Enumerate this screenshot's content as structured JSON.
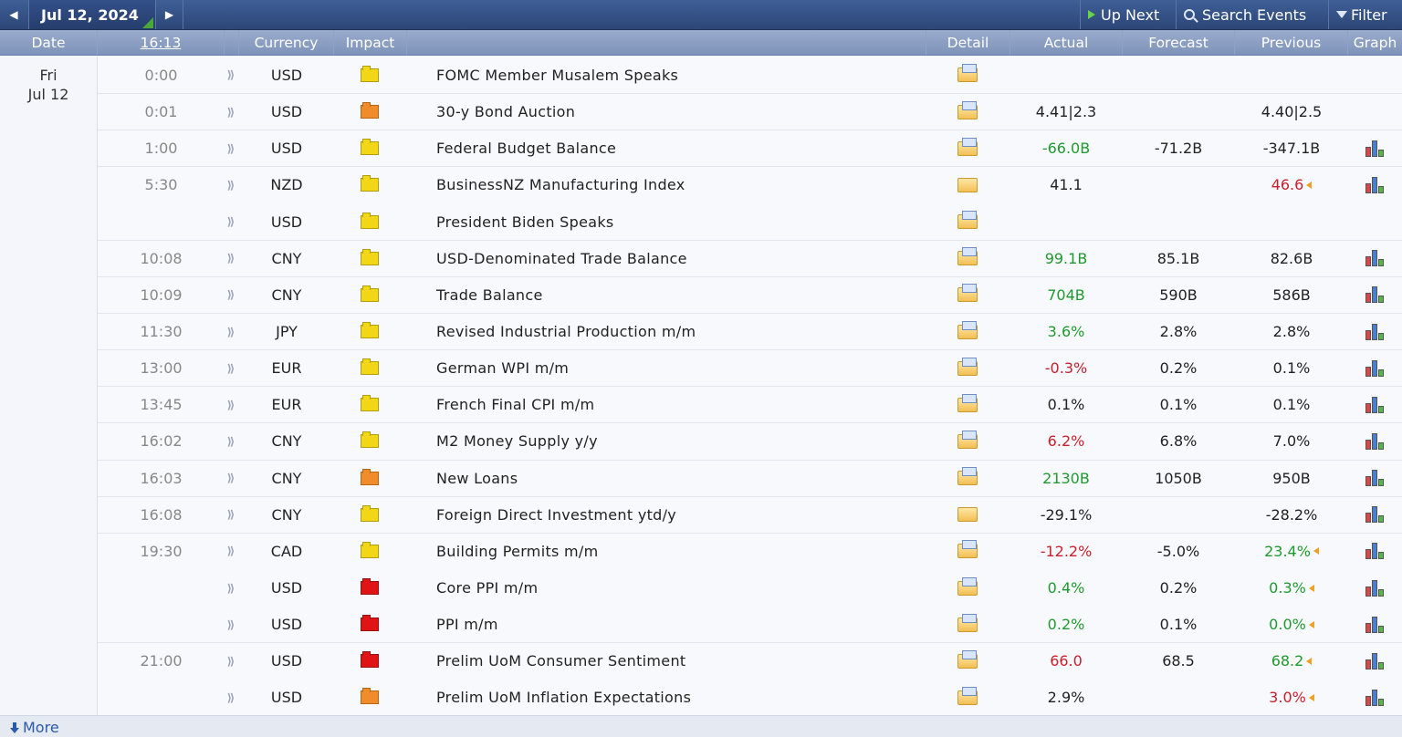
{
  "toolbar": {
    "date": "Jul 12, 2024",
    "up_next": "Up Next",
    "search": "Search Events",
    "filter": "Filter"
  },
  "columns": {
    "date": "Date",
    "time": "16:13",
    "currency": "Currency",
    "impact": "Impact",
    "detail": "Detail",
    "actual": "Actual",
    "forecast": "Forecast",
    "previous": "Previous",
    "graph": "Graph"
  },
  "day": {
    "weekday": "Fri",
    "date": "Jul 12"
  },
  "colors": {
    "topbar": "#2c4677",
    "header": "#8b9ec3",
    "positive": "#1f9a2e",
    "negative": "#c8202c",
    "impact_low": "#f2d716",
    "impact_medium": "#f08c2a",
    "impact_high": "#e01414"
  },
  "events": [
    {
      "time": "0:00",
      "currency": "USD",
      "impact": "yellow",
      "event": "FOMC Member Musalem Speaks",
      "detail_icon": "folder-doc-icon",
      "actual": "",
      "actual_color": "",
      "forecast": "",
      "previous": "",
      "previous_color": "",
      "revised": false,
      "graph": false
    },
    {
      "time": "0:01",
      "currency": "USD",
      "impact": "orange",
      "event": "30-y Bond Auction",
      "detail_icon": "folder-doc-icon",
      "actual": "4.41|2.3",
      "actual_color": "",
      "forecast": "",
      "previous": "4.40|2.5",
      "previous_color": "",
      "revised": false,
      "graph": false
    },
    {
      "time": "1:00",
      "currency": "USD",
      "impact": "yellow",
      "event": "Federal Budget Balance",
      "detail_icon": "folder-doc-icon",
      "actual": "-66.0B",
      "actual_color": "green",
      "forecast": "-71.2B",
      "previous": "-347.1B",
      "previous_color": "",
      "revised": false,
      "graph": true
    },
    {
      "time": "5:30",
      "currency": "NZD",
      "impact": "yellow",
      "event": "BusinessNZ Manufacturing Index",
      "detail_icon": "folder-icon",
      "actual": "41.1",
      "actual_color": "",
      "forecast": "",
      "previous": "46.6",
      "previous_color": "red",
      "revised": true,
      "graph": true
    },
    {
      "time": "",
      "currency": "USD",
      "impact": "yellow",
      "event": "President Biden Speaks",
      "detail_icon": "folder-doc-icon",
      "actual": "",
      "actual_color": "",
      "forecast": "",
      "previous": "",
      "previous_color": "",
      "revised": false,
      "graph": false
    },
    {
      "time": "10:08",
      "currency": "CNY",
      "impact": "yellow",
      "event": "USD-Denominated Trade Balance",
      "detail_icon": "folder-doc-icon",
      "actual": "99.1B",
      "actual_color": "green",
      "forecast": "85.1B",
      "previous": "82.6B",
      "previous_color": "",
      "revised": false,
      "graph": true
    },
    {
      "time": "10:09",
      "currency": "CNY",
      "impact": "yellow",
      "event": "Trade Balance",
      "detail_icon": "folder-doc-icon",
      "actual": "704B",
      "actual_color": "green",
      "forecast": "590B",
      "previous": "586B",
      "previous_color": "",
      "revised": false,
      "graph": true
    },
    {
      "time": "11:30",
      "currency": "JPY",
      "impact": "yellow",
      "event": "Revised Industrial Production m/m",
      "detail_icon": "folder-doc-icon",
      "actual": "3.6%",
      "actual_color": "green",
      "forecast": "2.8%",
      "previous": "2.8%",
      "previous_color": "",
      "revised": false,
      "graph": true
    },
    {
      "time": "13:00",
      "currency": "EUR",
      "impact": "yellow",
      "event": "German WPI m/m",
      "detail_icon": "folder-doc-icon",
      "actual": "-0.3%",
      "actual_color": "red",
      "forecast": "0.2%",
      "previous": "0.1%",
      "previous_color": "",
      "revised": false,
      "graph": true
    },
    {
      "time": "13:45",
      "currency": "EUR",
      "impact": "yellow",
      "event": "French Final CPI m/m",
      "detail_icon": "folder-doc-icon",
      "actual": "0.1%",
      "actual_color": "",
      "forecast": "0.1%",
      "previous": "0.1%",
      "previous_color": "",
      "revised": false,
      "graph": true
    },
    {
      "time": "16:02",
      "currency": "CNY",
      "impact": "yellow",
      "event": "M2 Money Supply y/y",
      "detail_icon": "folder-doc-icon",
      "actual": "6.2%",
      "actual_color": "red",
      "forecast": "6.8%",
      "previous": "7.0%",
      "previous_color": "",
      "revised": false,
      "graph": true
    },
    {
      "time": "16:03",
      "currency": "CNY",
      "impact": "orange",
      "event": "New Loans",
      "detail_icon": "folder-doc-icon",
      "actual": "2130B",
      "actual_color": "green",
      "forecast": "1050B",
      "previous": "950B",
      "previous_color": "",
      "revised": false,
      "graph": true
    },
    {
      "time": "16:08",
      "currency": "CNY",
      "impact": "yellow",
      "event": "Foreign Direct Investment ytd/y",
      "detail_icon": "folder-icon",
      "actual": "-29.1%",
      "actual_color": "",
      "forecast": "",
      "previous": "-28.2%",
      "previous_color": "",
      "revised": false,
      "graph": true
    },
    {
      "time": "19:30",
      "currency": "CAD",
      "impact": "yellow",
      "event": "Building Permits m/m",
      "detail_icon": "folder-doc-icon",
      "actual": "-12.2%",
      "actual_color": "red",
      "forecast": "-5.0%",
      "previous": "23.4%",
      "previous_color": "green",
      "revised": true,
      "graph": true
    },
    {
      "time": "",
      "currency": "USD",
      "impact": "red",
      "event": "Core PPI m/m",
      "detail_icon": "folder-doc-icon",
      "actual": "0.4%",
      "actual_color": "green",
      "forecast": "0.2%",
      "previous": "0.3%",
      "previous_color": "green",
      "revised": true,
      "graph": true
    },
    {
      "time": "",
      "currency": "USD",
      "impact": "red",
      "event": "PPI m/m",
      "detail_icon": "folder-doc-icon",
      "actual": "0.2%",
      "actual_color": "green",
      "forecast": "0.1%",
      "previous": "0.0%",
      "previous_color": "green",
      "revised": true,
      "graph": true
    },
    {
      "time": "21:00",
      "currency": "USD",
      "impact": "red",
      "event": "Prelim UoM Consumer Sentiment",
      "detail_icon": "folder-doc-icon",
      "actual": "66.0",
      "actual_color": "red",
      "forecast": "68.5",
      "previous": "68.2",
      "previous_color": "green",
      "revised": true,
      "graph": true
    },
    {
      "time": "",
      "currency": "USD",
      "impact": "orange",
      "event": "Prelim UoM Inflation Expectations",
      "detail_icon": "folder-doc-icon",
      "actual": "2.9%",
      "actual_color": "",
      "forecast": "",
      "previous": "3.0%",
      "previous_color": "red",
      "revised": true,
      "graph": true
    }
  ],
  "footer": {
    "more": "More"
  }
}
